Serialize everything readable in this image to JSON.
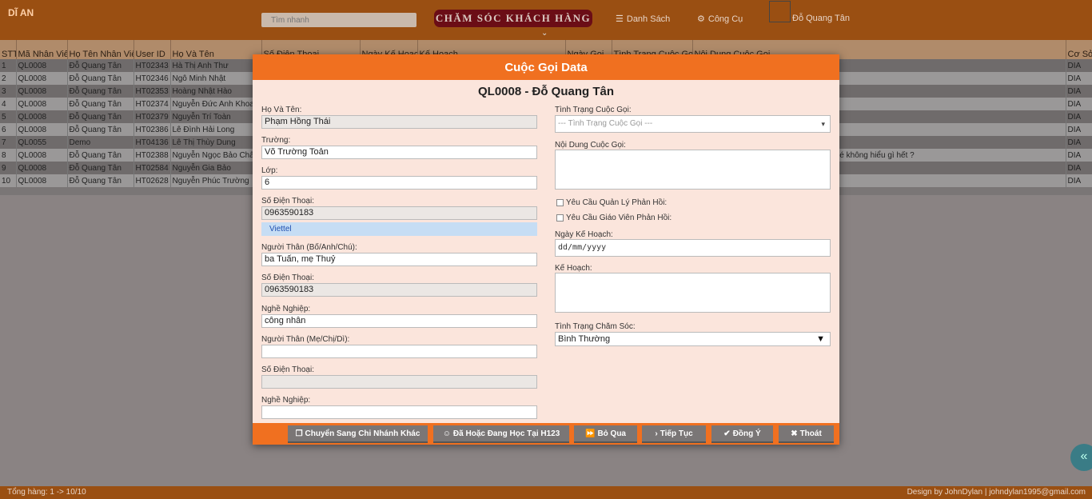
{
  "header": {
    "brand": "DĨ AN",
    "search_placeholder": "Tìm nhanh",
    "title_button": "CHĂM SÓC KHÁCH HÀNG",
    "nav_list": "Danh Sách",
    "nav_tools": "Công Cụ",
    "user_name": "Đỗ Quang Tân"
  },
  "table": {
    "columns": [
      "STT",
      "Mã Nhân Viên",
      "Họ Tên Nhân Viên",
      "User ID",
      "Họ Và Tên",
      "Số Điện Thoại",
      "Ngày Kế Hoạch",
      "Kế Hoạch",
      "Ngày Gọi",
      "Tình Trạng Cuộc Gọi",
      "Nội Dung Cuộc Gọi",
      "Cơ Sở"
    ],
    "rows": [
      [
        "1",
        "QL0008",
        "Đỗ Quang Tân",
        "HT02343",
        "Hà Thị Anh Thư",
        "",
        "",
        "",
        "",
        "",
        "",
        "DIA"
      ],
      [
        "2",
        "QL0008",
        "Đỗ Quang Tân",
        "HT02346",
        "Ngô Minh Nhật",
        "",
        "",
        "",
        "",
        "",
        "",
        "DIA"
      ],
      [
        "3",
        "QL0008",
        "Đỗ Quang Tân",
        "HT02353",
        "Hoàng Nhật Hào",
        "",
        "",
        "",
        "",
        "",
        "",
        "DIA"
      ],
      [
        "4",
        "QL0008",
        "Đỗ Quang Tân",
        "HT02374",
        "Nguyễn Đức Anh Khoa",
        "",
        "",
        "",
        "",
        "",
        "",
        "DIA"
      ],
      [
        "5",
        "QL0008",
        "Đỗ Quang Tân",
        "HT02379",
        "Nguyễn Trí Toàn",
        "",
        "",
        "",
        "",
        "",
        "",
        "DIA"
      ],
      [
        "6",
        "QL0008",
        "Đỗ Quang Tân",
        "HT02386",
        "Lê Đình Hải Long",
        "",
        "",
        "",
        "",
        "",
        "",
        "DIA"
      ],
      [
        "7",
        "QL0055",
        "Demo",
        "HT04136",
        "Lê Thị Thùy Dung",
        "",
        "",
        "",
        "",
        "",
        "",
        "DIA"
      ],
      [
        "8",
        "QL0008",
        "Đỗ Quang Tân",
        "HT02388",
        "Nguyễn Ngọc Bảo Châu",
        "",
        "",
        "",
        "",
        "",
        "? hay không mà về nhà bé ko tôi hỏi lại bé không hiểu gì hết ?",
        "DIA"
      ],
      [
        "9",
        "QL0008",
        "Đỗ Quang Tân",
        "HT02584",
        "Nguyễn Gia Bảo",
        "",
        "",
        "",
        "",
        "",
        "",
        "DIA"
      ],
      [
        "10",
        "QL0008",
        "Đỗ Quang Tân",
        "HT02628",
        "Nguyễn Phúc Trường",
        "",
        "",
        "",
        "",
        "",
        "",
        "DIA"
      ]
    ]
  },
  "footer": {
    "total": "Tổng hàng: 1 -> 10/10",
    "credit": "Design by JohnDylan | johndylan1995@gmail.com"
  },
  "modal": {
    "title": "Cuộc Gọi Data",
    "subtitle": "QL0008 - Đỗ Quang Tân",
    "left": {
      "name_label": "Họ Và Tên:",
      "name_value": "Phạm Hồng Thái",
      "school_label": "Trường:",
      "school_value": "Võ Trường Toản",
      "class_label": "Lớp:",
      "class_value": "6",
      "phone_label": "Số Điện Thoại:",
      "phone_value": "0963590183",
      "carrier": "Viettel",
      "relative1_label": "Người Thân (Bố/Anh/Chú):",
      "relative1_value": "ba Tuấn, mẹ Thuỷ",
      "phone2_label": "Số Điện Thoại:",
      "phone2_value": "0963590183",
      "job1_label": "Nghề Nghiệp:",
      "job1_value": "công nhân",
      "relative2_label": "Người Thân (Mẹ/Chị/Dì):",
      "relative2_value": "",
      "phone3_label": "Số Điện Thoại:",
      "phone3_value": "",
      "job2_label": "Nghề Nghiệp:",
      "job2_value": ""
    },
    "right": {
      "call_status_label": "Tình Trạng Cuộc Gọi:",
      "call_status_placeholder": "--- Tình Trạng Cuộc Gọi ---",
      "call_content_label": "Nội Dung Cuộc Gọi:",
      "chk_manager": "Yêu Cầu Quản Lý Phản Hồi:",
      "chk_teacher": "Yêu Cầu Giáo Viên Phản Hồi:",
      "plan_date_label": "Ngày Kế Hoạch:",
      "plan_date_placeholder": "dd/mm/yyyy",
      "plan_label": "Kế Hoạch:",
      "care_status_label": "Tình Trạng Chăm Sóc:",
      "care_status_value": "Bình Thường"
    },
    "buttons": {
      "transfer": "Chuyển Sang Chi Nhánh Khác",
      "studied": "Đã Hoặc Đang Học Tại H123",
      "skip": "Bỏ Qua",
      "continue": "Tiếp Tục",
      "agree": "Đồng Ý",
      "exit": "Thoát"
    }
  },
  "colors": {
    "accent": "#f07020",
    "topbar": "#9a4f12",
    "title_button": "#6b0d16"
  }
}
